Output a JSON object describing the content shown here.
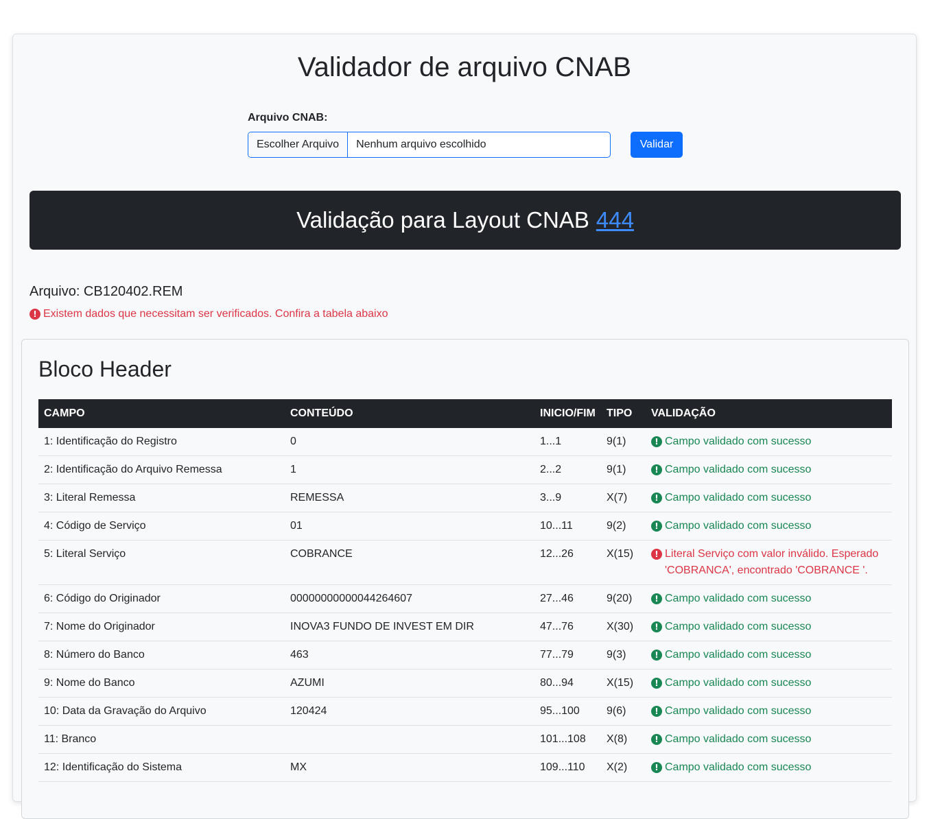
{
  "page": {
    "title": "Validador de arquivo CNAB"
  },
  "upload": {
    "label": "Arquivo CNAB:",
    "choose_button": "Escolher Arquivo",
    "file_status": "Nenhum arquivo escolhido",
    "submit_button": "Validar"
  },
  "banner": {
    "text": "Validação para Layout CNAB",
    "link": "444"
  },
  "result": {
    "file_label": "Arquivo: CB120402.REM",
    "warning": "Existem dados que necessitam ser verificados. Confira a tabela abaixo"
  },
  "block": {
    "title": "Bloco Header",
    "columns": [
      "CAMPO",
      "CONTEÚDO",
      "INICIO/FIM",
      "TIPO",
      "VALIDAÇÃO"
    ],
    "rows": [
      {
        "campo": "1: Identificação do Registro",
        "conteudo": "0",
        "pos": "1...1",
        "tipo": "9(1)",
        "validacao": "Campo validado com sucesso",
        "status": "ok"
      },
      {
        "campo": "2: Identificação do Arquivo Remessa",
        "conteudo": "1",
        "pos": "2...2",
        "tipo": "9(1)",
        "validacao": "Campo validado com sucesso",
        "status": "ok"
      },
      {
        "campo": "3: Literal Remessa",
        "conteudo": "REMESSA",
        "pos": "3...9",
        "tipo": "X(7)",
        "validacao": "Campo validado com sucesso",
        "status": "ok"
      },
      {
        "campo": "4: Código de Serviço",
        "conteudo": "01",
        "pos": "10...11",
        "tipo": "9(2)",
        "validacao": "Campo validado com sucesso",
        "status": "ok"
      },
      {
        "campo": "5: Literal Serviço",
        "conteudo": "COBRANCE",
        "pos": "12...26",
        "tipo": "X(15)",
        "validacao": "Literal Serviço com valor inválido. Esperado 'COBRANCA', encontrado 'COBRANCE '.",
        "status": "error"
      },
      {
        "campo": "6: Código do Originador",
        "conteudo": "00000000000044264607",
        "pos": "27...46",
        "tipo": "9(20)",
        "validacao": "Campo validado com sucesso",
        "status": "ok"
      },
      {
        "campo": "7: Nome do Originador",
        "conteudo": "INOVA3 FUNDO DE INVEST EM DIR",
        "pos": "47...76",
        "tipo": "X(30)",
        "validacao": "Campo validado com sucesso",
        "status": "ok"
      },
      {
        "campo": "8: Número do Banco",
        "conteudo": "463",
        "pos": "77...79",
        "tipo": "9(3)",
        "validacao": "Campo validado com sucesso",
        "status": "ok"
      },
      {
        "campo": "9: Nome do Banco",
        "conteudo": "AZUMI",
        "pos": "80...94",
        "tipo": "X(15)",
        "validacao": "Campo validado com sucesso",
        "status": "ok"
      },
      {
        "campo": "10: Data da Gravação do Arquivo",
        "conteudo": "120424",
        "pos": "95...100",
        "tipo": "9(6)",
        "validacao": "Campo validado com sucesso",
        "status": "ok"
      },
      {
        "campo": "11: Branco",
        "conteudo": "",
        "pos": "101...108",
        "tipo": "X(8)",
        "validacao": "Campo validado com sucesso",
        "status": "ok"
      },
      {
        "campo": "12: Identificação do Sistema",
        "conteudo": "MX",
        "pos": "109...110",
        "tipo": "X(2)",
        "validacao": "Campo validado com sucesso",
        "status": "ok"
      }
    ]
  },
  "colors": {
    "primary": "#0d6efd",
    "dark": "#212529",
    "success": "#198754",
    "danger": "#dc3545"
  }
}
